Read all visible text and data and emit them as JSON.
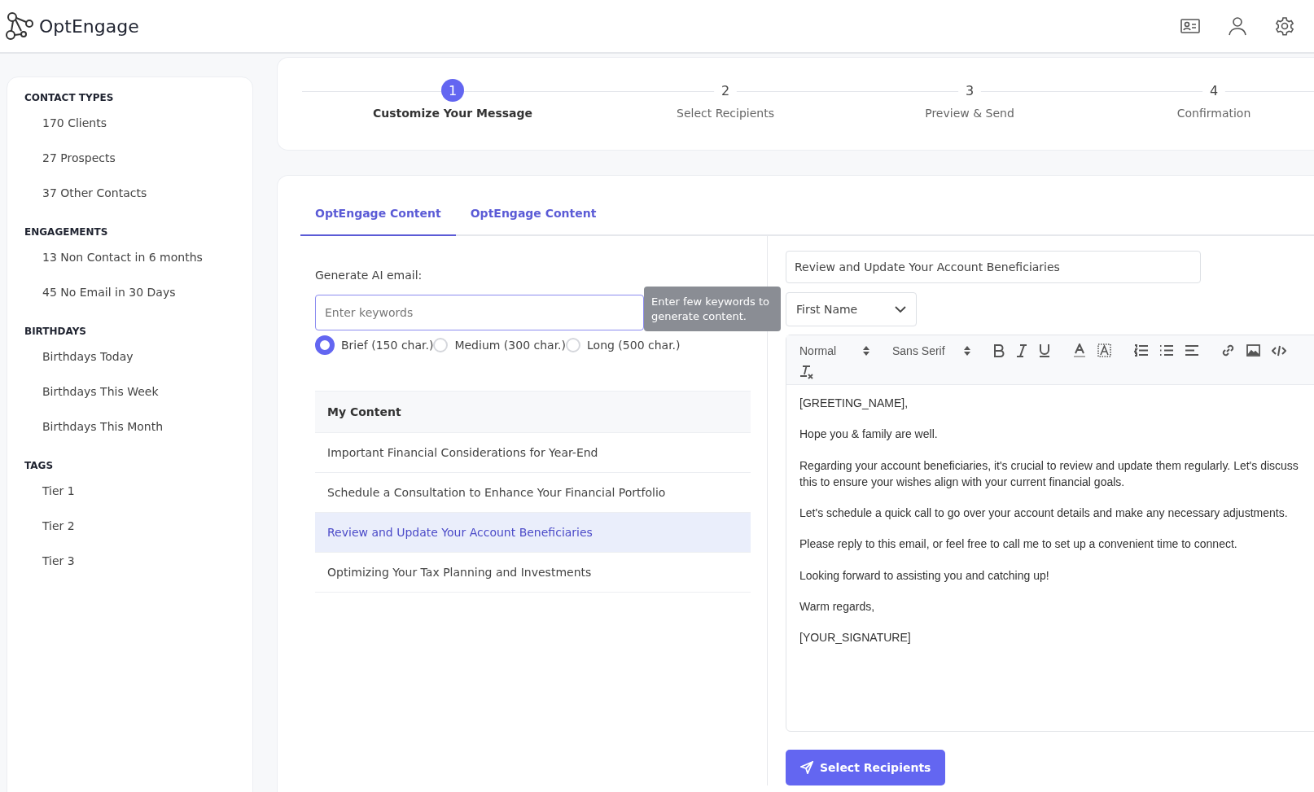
{
  "header": {
    "brand": "OptEngage"
  },
  "sidebar": {
    "sections": [
      {
        "title": "CONTACT TYPES",
        "items": [
          "170 Clients",
          "27 Prospects",
          "37 Other Contacts"
        ]
      },
      {
        "title": "ENGAGEMENTS",
        "items": [
          "13 Non Contact in 6 months",
          "45 No Email in 30 Days"
        ]
      },
      {
        "title": "BIRTHDAYS",
        "items": [
          "Birthdays Today",
          "Birthdays This Week",
          "Birthdays This Month"
        ]
      },
      {
        "title": "TAGS",
        "items": [
          "Tier 1",
          "Tier 2",
          "Tier 3"
        ]
      }
    ]
  },
  "steps": [
    {
      "number": "1",
      "label": "Customize Your Message",
      "selected": true
    },
    {
      "number": "2",
      "label": "Select Recipients",
      "selected": false
    },
    {
      "number": "3",
      "label": "Preview & Send",
      "selected": false
    },
    {
      "number": "4",
      "label": "Confirmation",
      "selected": false
    }
  ],
  "tabs": [
    {
      "label": "OptEngage Content",
      "selected": true
    },
    {
      "label": "OptEngage Content",
      "selected": false
    }
  ],
  "generator": {
    "label": "Generate AI email:",
    "placeholder": "Enter keywords",
    "tooltip": "Enter few keywords to generate content.",
    "lengths": [
      {
        "label": "Brief (150 char.)",
        "selected": true
      },
      {
        "label": "Medium (300 char.)",
        "selected": false
      },
      {
        "label": "Long (500 char.)",
        "selected": false
      }
    ]
  },
  "my_content": {
    "title": "My Content",
    "items": [
      {
        "title": "Important Financial Considerations for Year-End",
        "selected": false
      },
      {
        "title": "Schedule a Consultation to Enhance Your Financial Portfolio",
        "selected": false
      },
      {
        "title": "Review and Update Your Account Beneficiaries",
        "selected": true
      },
      {
        "title": "Optimizing Your Tax Planning and Investments",
        "selected": false
      }
    ]
  },
  "editor": {
    "subject": "Review and Update Your Account Beneficiaries",
    "merge_field": "First Name",
    "size": "Normal",
    "font": "Sans Serif",
    "body": [
      "[GREETING_NAME],",
      "Hope you & family are well.",
      "Regarding your account beneficiaries, it's crucial to review and update them regularly. Let's discuss this to ensure your wishes align with your current financial goals.",
      "Let's schedule a quick call to go over your account details and make any necessary adjustments.",
      "Please reply to this email, or feel free to call me to set up a convenient time to connect.",
      "Looking forward to assisting you and catching up!",
      "Warm regards,",
      "[YOUR_SIGNATURE]"
    ]
  },
  "primary_button": "Select Recipients"
}
